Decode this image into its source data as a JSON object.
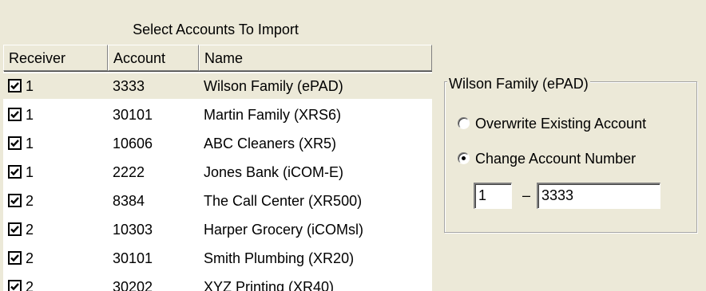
{
  "panel": {
    "title": "Select Accounts To Import"
  },
  "table": {
    "columns": [
      "Receiver",
      "Account",
      "Name"
    ],
    "rows": [
      {
        "checked": true,
        "receiver": "1",
        "account": "3333",
        "name": "Wilson Family (ePAD)",
        "selected": true
      },
      {
        "checked": true,
        "receiver": "1",
        "account": "30101",
        "name": "Martin Family (XRS6)"
      },
      {
        "checked": true,
        "receiver": "1",
        "account": "10606",
        "name": "ABC Cleaners (XR5)"
      },
      {
        "checked": true,
        "receiver": "1",
        "account": "2222",
        "name": "Jones Bank (iCOM-E)"
      },
      {
        "checked": true,
        "receiver": "2",
        "account": "8384",
        "name": "The Call Center (XR500)"
      },
      {
        "checked": true,
        "receiver": "2",
        "account": "10303",
        "name": "Harper Grocery (iCOMsl)"
      },
      {
        "checked": true,
        "receiver": "2",
        "account": "30101",
        "name": "Smith Plumbing (XR20)"
      },
      {
        "checked": true,
        "receiver": "2",
        "account": "30202",
        "name": "XYZ Printing (XR40)"
      }
    ]
  },
  "options": {
    "group_title": "Wilson Family (ePAD)",
    "overwrite_label": "Overwrite Existing Account",
    "change_label": "Change Account Number",
    "selected_option": "change",
    "dash": "–",
    "receiver_value": "1",
    "account_value": "3333"
  },
  "icons": {
    "checkbox": "checkbox-checked-icon",
    "radio": "radio-icon"
  }
}
